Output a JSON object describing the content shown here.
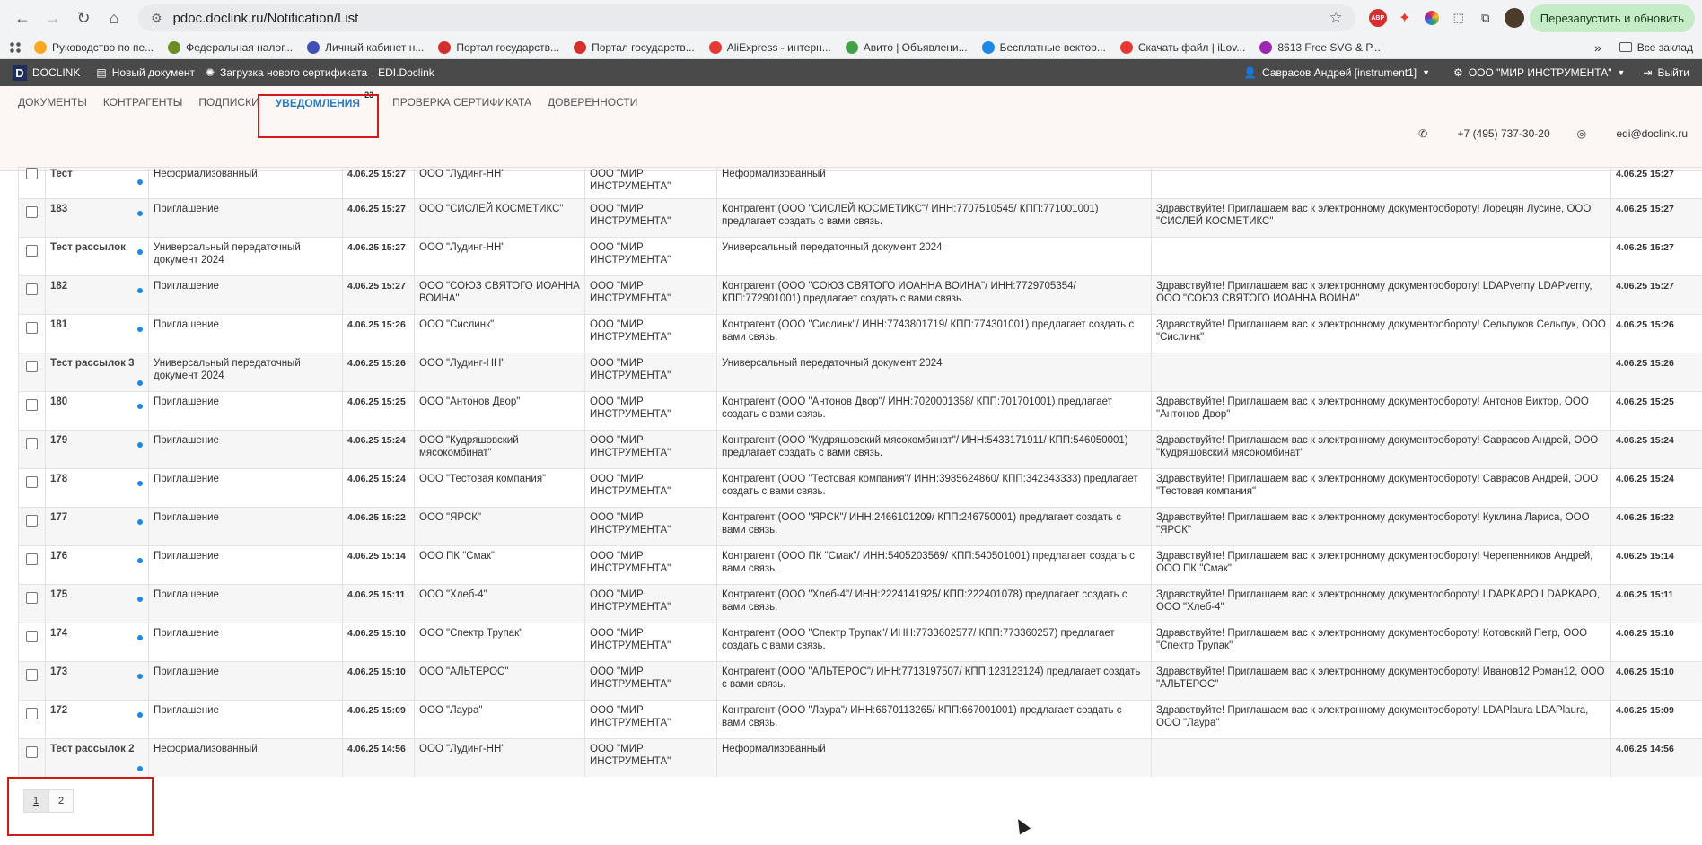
{
  "browser": {
    "url": "pdoc.doclink.ru/Notification/List",
    "relaunch_label": "Перезапустить и обновить",
    "bookmarks": [
      {
        "label": "Руководство по пе...",
        "color": "#f9a825"
      },
      {
        "label": "Федеральная налог...",
        "color": "#6b8e23"
      },
      {
        "label": "Личный кабинет н...",
        "color": "#3f51b5"
      },
      {
        "label": "Портал государств...",
        "color": "#d32f2f"
      },
      {
        "label": "Портал государств...",
        "color": "#d32f2f"
      },
      {
        "label": "AliExpress - интерн...",
        "color": "#e53935"
      },
      {
        "label": "Авито | Объявлени...",
        "color": "#43a047"
      },
      {
        "label": "Бесплатные вектор...",
        "color": "#1e88e5"
      },
      {
        "label": "Скачать файл | iLov...",
        "color": "#e53935"
      },
      {
        "label": "8613 Free SVG & P...",
        "color": "#9c27b0"
      }
    ],
    "all_bookmarks_label": "Все заклад"
  },
  "app": {
    "brand": "DOCLINK",
    "new_doc": "Новый документ",
    "upload_cert": "Загрузка нового сертификата",
    "edi": "EDI.Doclink",
    "user": "Саврасов Андрей [instrument1]",
    "org": "ООО \"МИР ИНСТРУМЕНТА\"",
    "logout": "Выйти"
  },
  "tabs": [
    {
      "label": "ДОКУМЕНТЫ"
    },
    {
      "label": "КОНТРАГЕНТЫ"
    },
    {
      "label": "ПОДПИСКИ"
    },
    {
      "label": "УВЕДОМЛЕНИЯ",
      "badge": "23"
    },
    {
      "label": "ПРОВЕРКА СЕРТИФИКАТА"
    },
    {
      "label": "ДОВЕРЕННОСТИ"
    }
  ],
  "contact": {
    "phone": "+7 (495) 737-30-20",
    "email": "edi@doclink.ru"
  },
  "rows": [
    {
      "num": "Тест",
      "type": "Неформализованный",
      "date": "4.06.25 15:27",
      "from": "ООО \"Лудинг-НН\"",
      "to": "ООО \"МИР ИНСТРУМЕНТА\"",
      "subject": "Неформализованный",
      "message": "",
      "date2": "4.06.25 15:27",
      "partial": true
    },
    {
      "num": "183",
      "type": "Приглашение",
      "date": "4.06.25 15:27",
      "from": "ООО \"СИСЛЕЙ КОСМЕТИКС\"",
      "to": "ООО \"МИР ИНСТРУМЕНТА\"",
      "subject": "Контрагент (ООО \"СИСЛЕЙ КОСМЕТИКС\"/ ИНН:7707510545/ КПП:771001001) предлагает создать с вами связь.",
      "message": "Здравствуйте! Приглашаем вас к электронному документообороту! Лорецян Лусине, ООО \"СИСЛЕЙ КОСМЕТИКС\"",
      "date2": "4.06.25 15:27"
    },
    {
      "num": "Тест рассылок",
      "type": "Универсальный передаточный документ 2024",
      "date": "4.06.25 15:27",
      "from": "ООО \"Лудинг-НН\"",
      "to": "ООО \"МИР ИНСТРУМЕНТА\"",
      "subject": "Универсальный передаточный документ 2024",
      "message": "",
      "date2": "4.06.25 15:27"
    },
    {
      "num": "182",
      "type": "Приглашение",
      "date": "4.06.25 15:27",
      "from": "ООО \"СОЮЗ СВЯТОГО ИОАННА ВОИНА\"",
      "to": "ООО \"МИР ИНСТРУМЕНТА\"",
      "subject": "Контрагент (ООО \"СОЮЗ СВЯТОГО ИОАННА ВОИНА\"/ ИНН:7729705354/ КПП:772901001) предлагает создать с вами связь.",
      "message": "Здравствуйте! Приглашаем вас к электронному документообороту! LDAPverny LDAPverny, ООО \"СОЮЗ СВЯТОГО ИОАННА ВОИНА\"",
      "date2": "4.06.25 15:27"
    },
    {
      "num": "181",
      "type": "Приглашение",
      "date": "4.06.25 15:26",
      "from": "ООО \"Сислинк\"",
      "to": "ООО \"МИР ИНСТРУМЕНТА\"",
      "subject": "Контрагент (ООО \"Сислинк\"/ ИНН:7743801719/ КПП:774301001) предлагает создать с вами связь.",
      "message": "Здравствуйте! Приглашаем вас к электронному документообороту! Сельпуков Сельпук, ООО \"Сислинк\"",
      "date2": "4.06.25 15:26"
    },
    {
      "num": "Тест рассылок 3",
      "type": "Универсальный передаточный документ 2024",
      "date": "4.06.25 15:26",
      "from": "ООО \"Лудинг-НН\"",
      "to": "ООО \"МИР ИНСТРУМЕНТА\"",
      "subject": "Универсальный передаточный документ 2024",
      "message": "",
      "date2": "4.06.25 15:26",
      "two": true
    },
    {
      "num": "180",
      "type": "Приглашение",
      "date": "4.06.25 15:25",
      "from": "ООО \"Антонов Двор\"",
      "to": "ООО \"МИР ИНСТРУМЕНТА\"",
      "subject": "Контрагент (ООО \"Антонов Двор\"/ ИНН:7020001358/ КПП:701701001) предлагает создать с вами связь.",
      "message": "Здравствуйте! Приглашаем вас к электронному документообороту! Антонов Виктор, ООО \"Антонов Двор\"",
      "date2": "4.06.25 15:25"
    },
    {
      "num": "179",
      "type": "Приглашение",
      "date": "4.06.25 15:24",
      "from": "ООО \"Кудряшовский мясокомбинат\"",
      "to": "ООО \"МИР ИНСТРУМЕНТА\"",
      "subject": "Контрагент (ООО \"Кудряшовский мясокомбинат\"/ ИНН:5433171911/ КПП:546050001) предлагает создать с вами связь.",
      "message": "Здравствуйте! Приглашаем вас к электронному документообороту! Саврасов Андрей, ООО \"Кудряшовский мясокомбинат\"",
      "date2": "4.06.25 15:24"
    },
    {
      "num": "178",
      "type": "Приглашение",
      "date": "4.06.25 15:24",
      "from": "ООО \"Тестовая компания\"",
      "to": "ООО \"МИР ИНСТРУМЕНТА\"",
      "subject": "Контрагент (ООО \"Тестовая компания\"/ ИНН:3985624860/ КПП:342343333) предлагает создать с вами связь.",
      "message": "Здравствуйте! Приглашаем вас к электронному документообороту! Саврасов Андрей, ООО \"Тестовая компания\"",
      "date2": "4.06.25 15:24"
    },
    {
      "num": "177",
      "type": "Приглашение",
      "date": "4.06.25 15:22",
      "from": "ООО \"ЯРСК\"",
      "to": "ООО \"МИР ИНСТРУМЕНТА\"",
      "subject": "Контрагент (ООО \"ЯРСК\"/ ИНН:2466101209/ КПП:246750001) предлагает создать с вами связь.",
      "message": "Здравствуйте! Приглашаем вас к электронному документообороту! Куклина Лариса, ООО \"ЯРСК\"",
      "date2": "4.06.25 15:22"
    },
    {
      "num": "176",
      "type": "Приглашение",
      "date": "4.06.25 15:14",
      "from": "ООО ПК \"Смак\"",
      "to": "ООО \"МИР ИНСТРУМЕНТА\"",
      "subject": "Контрагент (ООО ПК \"Смак\"/ ИНН:5405203569/ КПП:540501001) предлагает создать с вами связь.",
      "message": "Здравствуйте! Приглашаем вас к электронному документообороту! Черепенников Андрей, ООО ПК \"Смак\"",
      "date2": "4.06.25 15:14"
    },
    {
      "num": "175",
      "type": "Приглашение",
      "date": "4.06.25 15:11",
      "from": "ООО \"Хлеб-4\"",
      "to": "ООО \"МИР ИНСТРУМЕНТА\"",
      "subject": "Контрагент (ООО \"Хлеб-4\"/ ИНН:2224141925/ КПП:222401078) предлагает создать с вами связь.",
      "message": "Здравствуйте! Приглашаем вас к электронному документообороту! LDAPKAPO LDAPKAPO, ООО \"Хлеб-4\"",
      "date2": "4.06.25 15:11"
    },
    {
      "num": "174",
      "type": "Приглашение",
      "date": "4.06.25 15:10",
      "from": "ООО \"Спектр Трупак\"",
      "to": "ООО \"МИР ИНСТРУМЕНТА\"",
      "subject": "Контрагент (ООО \"Спектр Трупак\"/ ИНН:7733602577/ КПП:773360257) предлагает создать с вами связь.",
      "message": "Здравствуйте! Приглашаем вас к электронному документообороту! Котовский Петр, ООО \"Спектр Трупак\"",
      "date2": "4.06.25 15:10"
    },
    {
      "num": "173",
      "type": "Приглашение",
      "date": "4.06.25 15:10",
      "from": "ООО \"АЛЬТЕРОС\"",
      "to": "ООО \"МИР ИНСТРУМЕНТА\"",
      "subject": "Контрагент (ООО \"АЛЬТЕРОС\"/ ИНН:7713197507/ КПП:123123124) предлагает создать с вами связь.",
      "message": "Здравствуйте! Приглашаем вас к электронному документообороту! Иванов12 Роман12, ООО \"АЛЬТЕРОС\"",
      "date2": "4.06.25 15:10"
    },
    {
      "num": "172",
      "type": "Приглашение",
      "date": "4.06.25 15:09",
      "from": "ООО \"Лаура\"",
      "to": "ООО \"МИР ИНСТРУМЕНТА\"",
      "subject": "Контрагент (ООО \"Лаура\"/ ИНН:6670113265/ КПП:667001001) предлагает создать с вами связь.",
      "message": "Здравствуйте! Приглашаем вас к электронному документообороту! LDAPlaura LDAPlaura, ООО \"Лаура\"",
      "date2": "4.06.25 15:09"
    },
    {
      "num": "Тест рассылок 2",
      "type": "Неформализованный",
      "date": "4.06.25 14:56",
      "from": "ООО \"Лудинг-НН\"",
      "to": "ООО \"МИР ИНСТРУМЕНТА\"",
      "subject": "Неформализованный",
      "message": "",
      "date2": "4.06.25 14:56",
      "two": true
    }
  ],
  "pager": [
    "1",
    "2"
  ]
}
